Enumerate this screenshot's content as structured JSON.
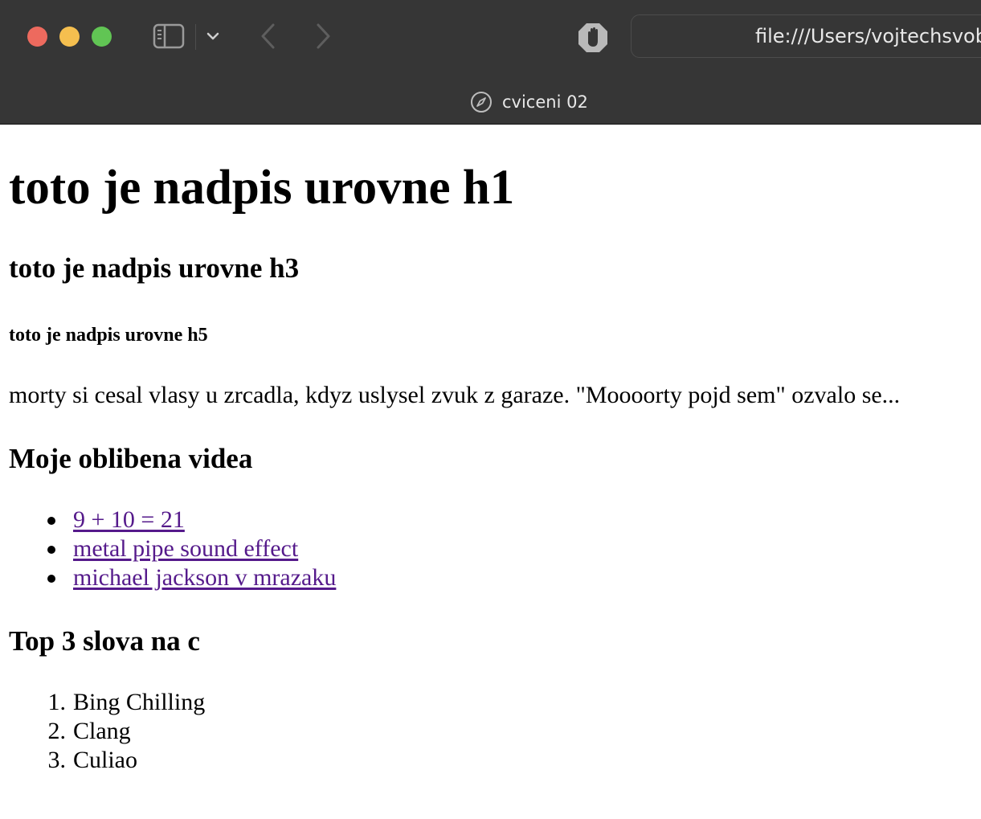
{
  "browser": {
    "address": "file:///Users/vojtechsvob",
    "tab_title": "cviceni 02",
    "icons": {
      "close": "close-dot",
      "minimize": "minimize-dot",
      "maximize": "maximize-dot",
      "sidebar": "sidebar-icon",
      "menu": "chevron-down-icon",
      "back": "chevron-left-icon",
      "forward": "chevron-right-icon",
      "adblock": "hand-stop-icon",
      "tab": "compass-icon"
    },
    "colors": {
      "chrome_bg": "#363636",
      "close": "#ed6a5e",
      "minimize": "#f5bf4f",
      "maximize": "#61c554",
      "visited_link": "#551a8b"
    }
  },
  "page": {
    "h1": "toto je nadpis urovne h1",
    "h3": "toto je nadpis urovne h3",
    "h5": "toto je nadpis urovne h5",
    "paragraph": "morty si cesal vlasy u zrcadla, kdyz uslysel zvuk z garaze. \"Moooorty pojd sem\" ozvalo se...",
    "videos_heading": "Moje oblibena videa",
    "videos": [
      {
        "label": "9 + 10 = 21"
      },
      {
        "label": "metal pipe sound effect"
      },
      {
        "label": "michael jackson v mrazaku"
      }
    ],
    "words_heading": "Top 3 slova na c",
    "words": [
      {
        "num": "1.",
        "label": "Bing Chilling"
      },
      {
        "num": "2.",
        "label": "Clang"
      },
      {
        "num": "3.",
        "label": "Culiao"
      }
    ]
  }
}
